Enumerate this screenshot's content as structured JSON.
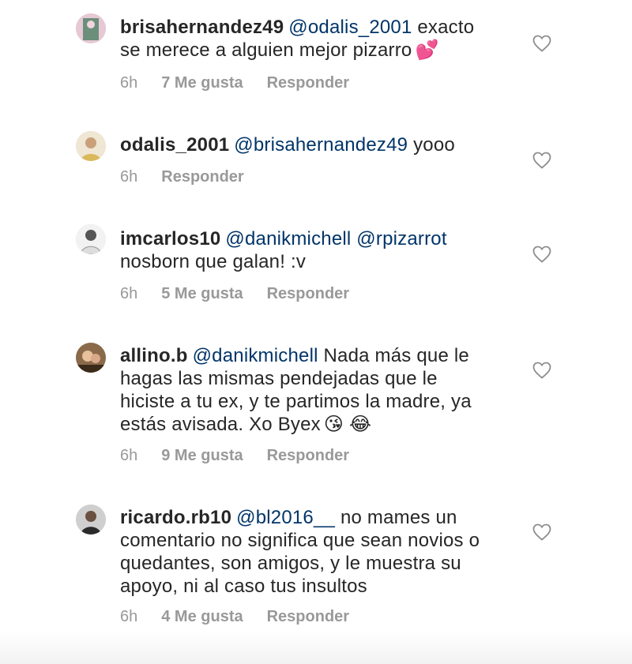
{
  "comments": [
    {
      "username": "brisahernandez49",
      "mention": "@odalis_2001",
      "text": " exacto se merece a alguien mejor pizarro",
      "emoji": "💕",
      "time": "6h",
      "likes": "7 Me gusta",
      "reply": "Responder"
    },
    {
      "username": "odalis_2001",
      "mention": "@brisahernandez49",
      "text": " yooo",
      "emoji": "",
      "time": "6h",
      "likes": "",
      "reply": "Responder"
    },
    {
      "username": "imcarlos10",
      "mention": "@danikmichell @rpizarrot",
      "text": " nosborn que galan! :v",
      "emoji": "",
      "time": "6h",
      "likes": "5 Me gusta",
      "reply": "Responder"
    },
    {
      "username": "allino.b",
      "mention": "@danikmichell",
      "text": " Nada más que le hagas las mismas pendejadas que le hiciste a tu ex, y te partimos la madre, ya estás avisada. Xo Byex",
      "emoji": "😘 😂",
      "time": "6h",
      "likes": "9 Me gusta",
      "reply": "Responder"
    },
    {
      "username": "ricardo.rb10",
      "mention": "@bl2016__",
      "text": " no mames un comentario no significa que sean novios o quedantes, son amigos, y le muestra su apoyo, ni al caso tus insultos",
      "emoji": "",
      "time": "6h",
      "likes": "4 Me gusta",
      "reply": "Responder"
    }
  ],
  "icons": {
    "like": "heart-outline-icon"
  },
  "colors": {
    "mention": "#003569",
    "meta": "#999999",
    "text": "#262626"
  }
}
